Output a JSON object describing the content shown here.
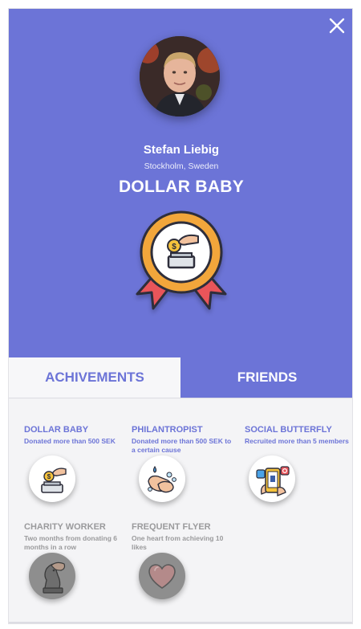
{
  "profile": {
    "name": "Stefan Liebig",
    "location": "Stockholm, Sweden",
    "current_title": "DOLLAR BABY"
  },
  "tabs": [
    {
      "label": "ACHIVEMENTS",
      "active": true
    },
    {
      "label": "FRIENDS",
      "active": false
    }
  ],
  "achievements": [
    {
      "title": "DOLLAR BABY",
      "description": "Donated more than 500 SEK",
      "icon": "coin-jar-icon",
      "unlocked": true
    },
    {
      "title": "PHILANTROPIST",
      "description": "Donated more than 500 SEK to a certain cause",
      "icon": "hand-wash-icon",
      "unlocked": true
    },
    {
      "title": "SOCIAL BUTTERFLY",
      "description": "Recruited more than 5 members",
      "icon": "social-phone-icon",
      "unlocked": true
    },
    {
      "title": "CHARITY WORKER",
      "description": "Two months from donating 6 months in a row",
      "icon": "chess-knight-icon",
      "unlocked": false
    },
    {
      "title": "FREQUENT FLYER",
      "description": "One heart from achieving 10 likes",
      "icon": "heart-icon",
      "unlocked": false
    }
  ],
  "colors": {
    "accent": "#6c74d7",
    "background": "#f4f4f6",
    "locked_text": "#9a9a9c",
    "locked_badge": "#8e8e8e",
    "medal_ring": "#f2a63b",
    "ribbon": "#e9545a"
  },
  "icons": {
    "close": "close-icon",
    "medal": "medal-icon"
  }
}
